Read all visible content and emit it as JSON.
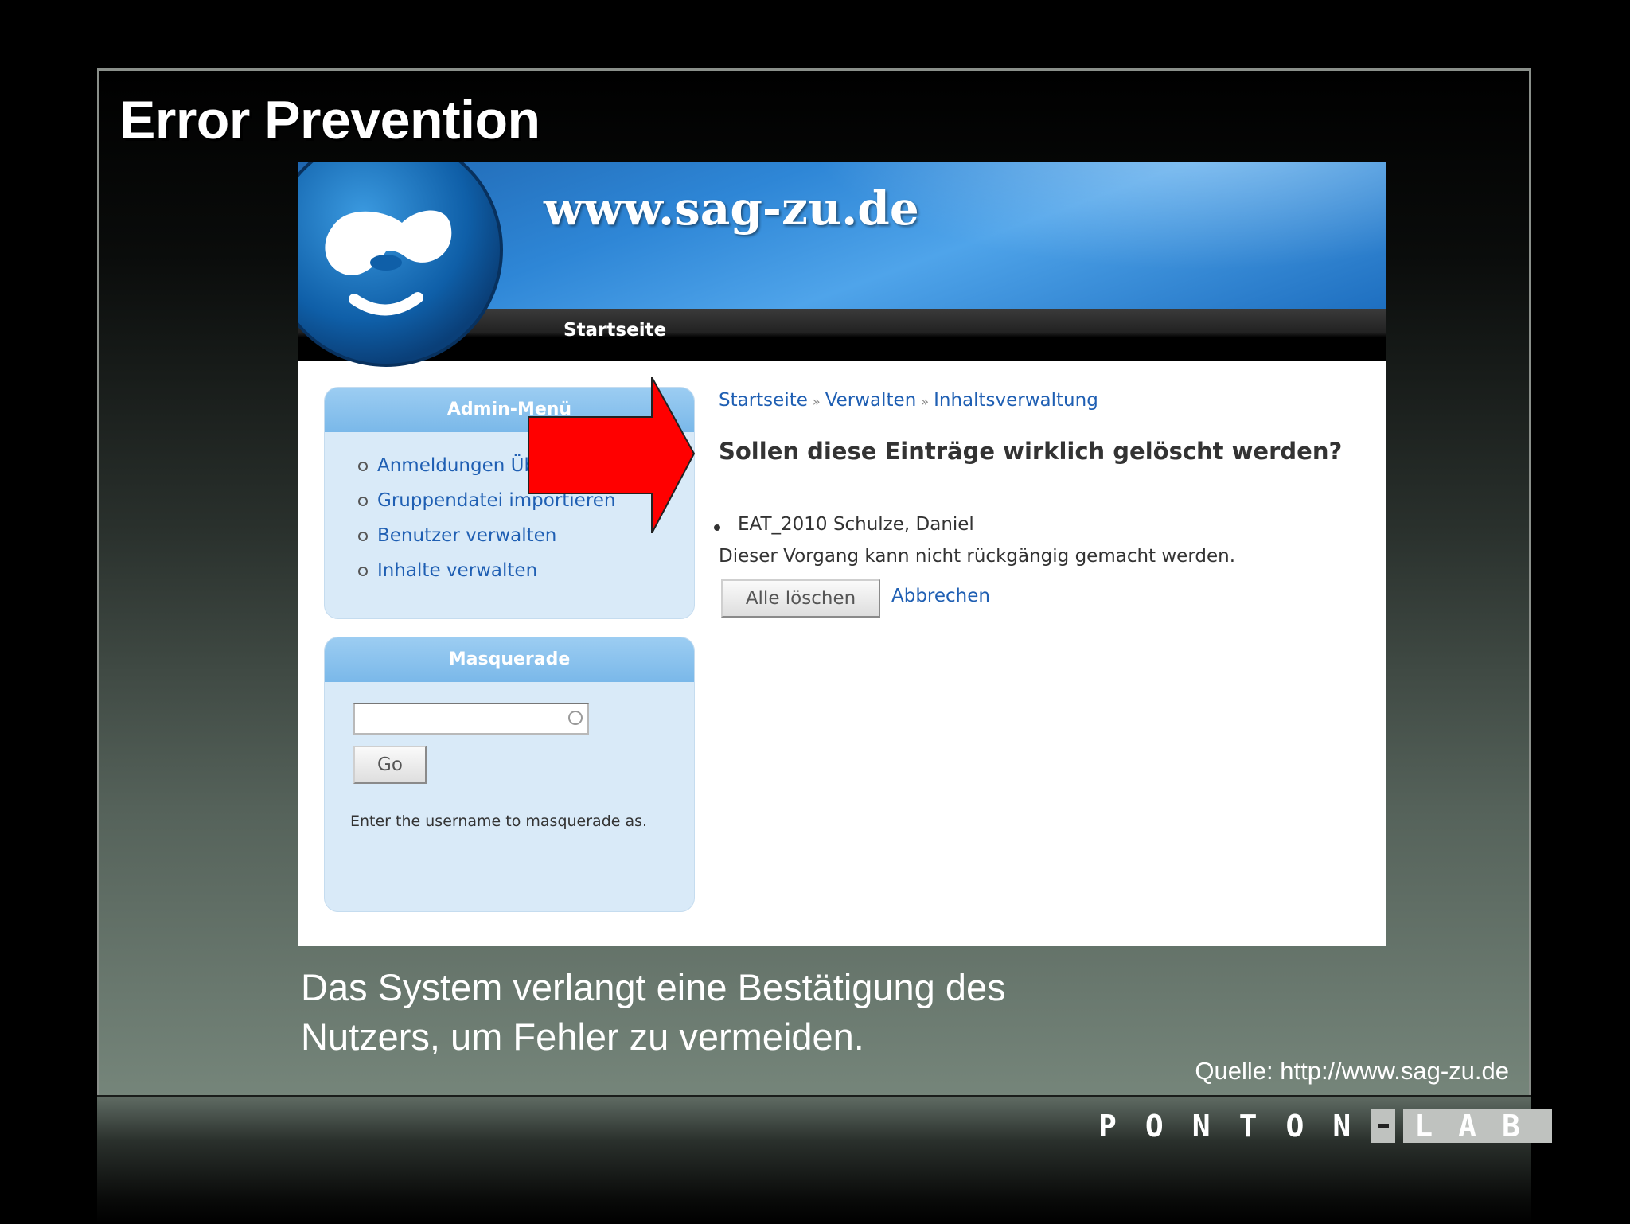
{
  "slide": {
    "title": "Error Prevention",
    "caption_line1": "Das System verlangt eine Bestätigung des",
    "caption_line2": "Nutzers, um Fehler zu vermeiden.",
    "source": "Quelle: http://www.sag-zu.de",
    "logo_letters": "PONTON",
    "logo_lab": "LAB"
  },
  "site": {
    "name": "www.sag-zu.de",
    "nav_home": "Startseite"
  },
  "admin_menu": {
    "title": "Admin-Menü",
    "items": [
      {
        "label": "Anmeldungen Übersicht"
      },
      {
        "label": "Gruppendatei importieren"
      },
      {
        "label": "Benutzer verwalten"
      },
      {
        "label": "Inhalte verwalten"
      }
    ]
  },
  "masquerade": {
    "title": "Masquerade",
    "input_value": "",
    "go_label": "Go",
    "help": "Enter the username to masquerade as."
  },
  "breadcrumb": [
    "Startseite",
    "Verwalten",
    "Inhaltsverwaltung"
  ],
  "breadcrumb_sep": "»",
  "confirm": {
    "question": "Sollen diese Einträge wirklich gelöscht werden?",
    "entry": "EAT_2010 Schulze, Daniel",
    "warning": "Dieser Vorgang kann nicht rückgängig gemacht werden.",
    "delete_label": "Alle löschen",
    "cancel_label": "Abbrechen"
  },
  "colors": {
    "arrow": "#ff0000",
    "link": "#1f5fb3",
    "header_blue": "#2e86d6"
  }
}
